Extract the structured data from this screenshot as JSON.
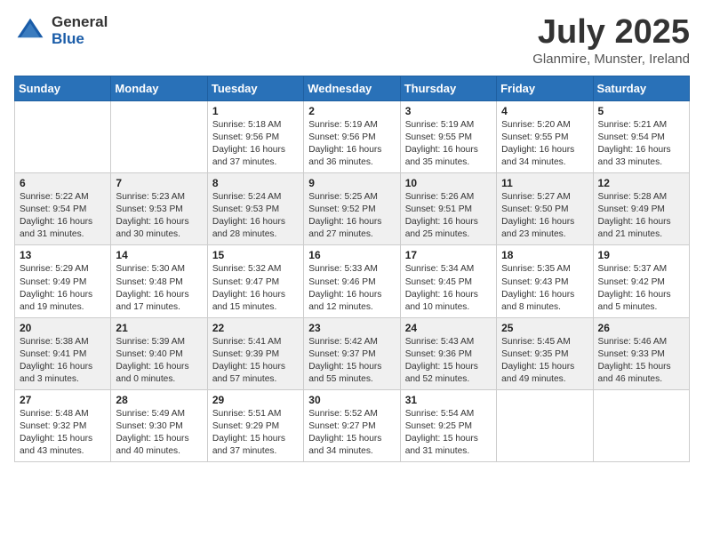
{
  "header": {
    "logo_general": "General",
    "logo_blue": "Blue",
    "month_title": "July 2025",
    "location": "Glanmire, Munster, Ireland"
  },
  "weekdays": [
    "Sunday",
    "Monday",
    "Tuesday",
    "Wednesday",
    "Thursday",
    "Friday",
    "Saturday"
  ],
  "weeks": [
    [
      {
        "day": "",
        "content": ""
      },
      {
        "day": "",
        "content": ""
      },
      {
        "day": "1",
        "content": "Sunrise: 5:18 AM\nSunset: 9:56 PM\nDaylight: 16 hours and 37 minutes."
      },
      {
        "day": "2",
        "content": "Sunrise: 5:19 AM\nSunset: 9:56 PM\nDaylight: 16 hours and 36 minutes."
      },
      {
        "day": "3",
        "content": "Sunrise: 5:19 AM\nSunset: 9:55 PM\nDaylight: 16 hours and 35 minutes."
      },
      {
        "day": "4",
        "content": "Sunrise: 5:20 AM\nSunset: 9:55 PM\nDaylight: 16 hours and 34 minutes."
      },
      {
        "day": "5",
        "content": "Sunrise: 5:21 AM\nSunset: 9:54 PM\nDaylight: 16 hours and 33 minutes."
      }
    ],
    [
      {
        "day": "6",
        "content": "Sunrise: 5:22 AM\nSunset: 9:54 PM\nDaylight: 16 hours and 31 minutes."
      },
      {
        "day": "7",
        "content": "Sunrise: 5:23 AM\nSunset: 9:53 PM\nDaylight: 16 hours and 30 minutes."
      },
      {
        "day": "8",
        "content": "Sunrise: 5:24 AM\nSunset: 9:53 PM\nDaylight: 16 hours and 28 minutes."
      },
      {
        "day": "9",
        "content": "Sunrise: 5:25 AM\nSunset: 9:52 PM\nDaylight: 16 hours and 27 minutes."
      },
      {
        "day": "10",
        "content": "Sunrise: 5:26 AM\nSunset: 9:51 PM\nDaylight: 16 hours and 25 minutes."
      },
      {
        "day": "11",
        "content": "Sunrise: 5:27 AM\nSunset: 9:50 PM\nDaylight: 16 hours and 23 minutes."
      },
      {
        "day": "12",
        "content": "Sunrise: 5:28 AM\nSunset: 9:49 PM\nDaylight: 16 hours and 21 minutes."
      }
    ],
    [
      {
        "day": "13",
        "content": "Sunrise: 5:29 AM\nSunset: 9:49 PM\nDaylight: 16 hours and 19 minutes."
      },
      {
        "day": "14",
        "content": "Sunrise: 5:30 AM\nSunset: 9:48 PM\nDaylight: 16 hours and 17 minutes."
      },
      {
        "day": "15",
        "content": "Sunrise: 5:32 AM\nSunset: 9:47 PM\nDaylight: 16 hours and 15 minutes."
      },
      {
        "day": "16",
        "content": "Sunrise: 5:33 AM\nSunset: 9:46 PM\nDaylight: 16 hours and 12 minutes."
      },
      {
        "day": "17",
        "content": "Sunrise: 5:34 AM\nSunset: 9:45 PM\nDaylight: 16 hours and 10 minutes."
      },
      {
        "day": "18",
        "content": "Sunrise: 5:35 AM\nSunset: 9:43 PM\nDaylight: 16 hours and 8 minutes."
      },
      {
        "day": "19",
        "content": "Sunrise: 5:37 AM\nSunset: 9:42 PM\nDaylight: 16 hours and 5 minutes."
      }
    ],
    [
      {
        "day": "20",
        "content": "Sunrise: 5:38 AM\nSunset: 9:41 PM\nDaylight: 16 hours and 3 minutes."
      },
      {
        "day": "21",
        "content": "Sunrise: 5:39 AM\nSunset: 9:40 PM\nDaylight: 16 hours and 0 minutes."
      },
      {
        "day": "22",
        "content": "Sunrise: 5:41 AM\nSunset: 9:39 PM\nDaylight: 15 hours and 57 minutes."
      },
      {
        "day": "23",
        "content": "Sunrise: 5:42 AM\nSunset: 9:37 PM\nDaylight: 15 hours and 55 minutes."
      },
      {
        "day": "24",
        "content": "Sunrise: 5:43 AM\nSunset: 9:36 PM\nDaylight: 15 hours and 52 minutes."
      },
      {
        "day": "25",
        "content": "Sunrise: 5:45 AM\nSunset: 9:35 PM\nDaylight: 15 hours and 49 minutes."
      },
      {
        "day": "26",
        "content": "Sunrise: 5:46 AM\nSunset: 9:33 PM\nDaylight: 15 hours and 46 minutes."
      }
    ],
    [
      {
        "day": "27",
        "content": "Sunrise: 5:48 AM\nSunset: 9:32 PM\nDaylight: 15 hours and 43 minutes."
      },
      {
        "day": "28",
        "content": "Sunrise: 5:49 AM\nSunset: 9:30 PM\nDaylight: 15 hours and 40 minutes."
      },
      {
        "day": "29",
        "content": "Sunrise: 5:51 AM\nSunset: 9:29 PM\nDaylight: 15 hours and 37 minutes."
      },
      {
        "day": "30",
        "content": "Sunrise: 5:52 AM\nSunset: 9:27 PM\nDaylight: 15 hours and 34 minutes."
      },
      {
        "day": "31",
        "content": "Sunrise: 5:54 AM\nSunset: 9:25 PM\nDaylight: 15 hours and 31 minutes."
      },
      {
        "day": "",
        "content": ""
      },
      {
        "day": "",
        "content": ""
      }
    ]
  ]
}
